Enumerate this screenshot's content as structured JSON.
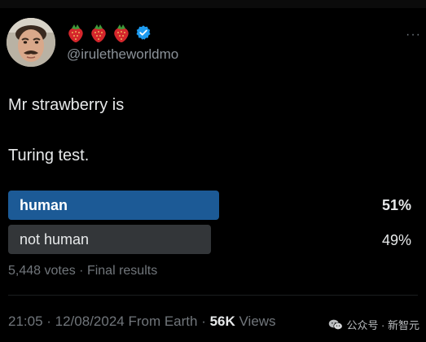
{
  "tweet": {
    "handle": "@iruletheworldmo",
    "display_name_icons": [
      "strawberry-icon",
      "strawberry-icon",
      "strawberry-icon",
      "verified-badge-icon"
    ],
    "more_label": "···",
    "lines": [
      "Mr strawberry is",
      "Turing test."
    ]
  },
  "poll": {
    "options": [
      {
        "label": "human",
        "percent": "51%",
        "value": 51,
        "winner": true
      },
      {
        "label": "not human",
        "percent": "49%",
        "value": 49,
        "winner": false
      }
    ],
    "votes_text": "5,448 votes · Final results"
  },
  "meta": {
    "timestamp": "21:05 · 12/08/2024 From Earth · ",
    "views_count": "56K",
    "views_label": " Views"
  },
  "watermark": {
    "text": "公众号 · 新智元",
    "icon": "wechat-icon"
  },
  "colors": {
    "background": "#000000",
    "winner_bar": "#1c5a96",
    "loser_bar": "#333639",
    "muted_text": "#71767b",
    "verified": "#1d9bf0",
    "strawberry": "#d5262c"
  }
}
